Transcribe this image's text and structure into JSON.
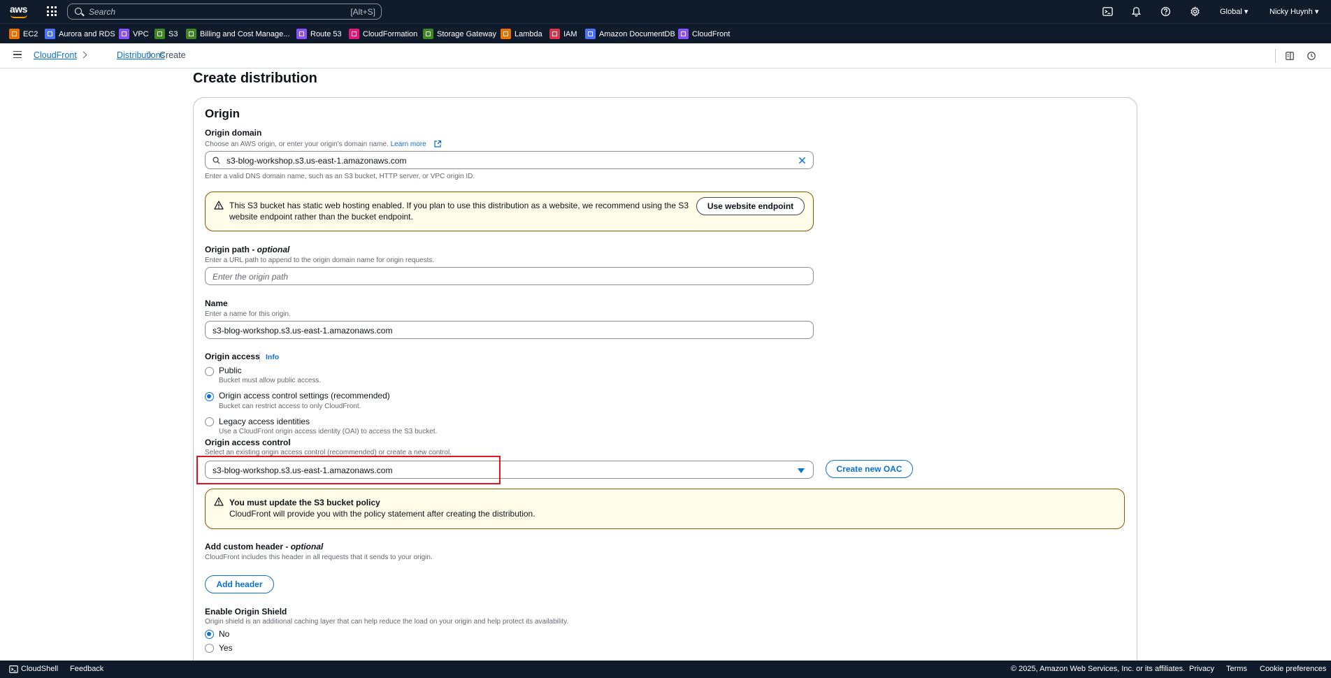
{
  "topnav": {
    "search_placeholder": "Search",
    "search_shortcut": "[Alt+S]",
    "region": "Global",
    "user": "Nicky Huynh"
  },
  "favorites": [
    {
      "label": "EC2",
      "color": "#ed7100"
    },
    {
      "label": "Aurora and RDS",
      "color": "#4d72f3"
    },
    {
      "label": "VPC",
      "color": "#8c4fff"
    },
    {
      "label": "S3",
      "color": "#3f8624"
    },
    {
      "label": "Billing and Cost Manage...",
      "color": "#3f8624"
    },
    {
      "label": "Route 53",
      "color": "#8c4fff"
    },
    {
      "label": "CloudFormation",
      "color": "#e7157b"
    },
    {
      "label": "Storage Gateway",
      "color": "#3f8624"
    },
    {
      "label": "Lambda",
      "color": "#ed7100"
    },
    {
      "label": "IAM",
      "color": "#dd344c"
    },
    {
      "label": "Amazon DocumentDB",
      "color": "#4d72f3"
    },
    {
      "label": "CloudFront",
      "color": "#8c4fff"
    }
  ],
  "breadcrumb": {
    "items": [
      "CloudFront",
      "Distributions",
      "Create"
    ]
  },
  "page": {
    "title": "Create distribution",
    "section_title": "Origin",
    "origin_domain": {
      "label": "Origin domain",
      "description": "Choose an AWS origin, or enter your origin's domain name.",
      "learn_more": "Learn more",
      "value": "s3-blog-workshop.s3.us-east-1.amazonaws.com",
      "hint": "Enter a valid DNS domain name, such as an S3 bucket, HTTP server, or VPC origin ID."
    },
    "website_alert": {
      "line1": "This S3 bucket has static web hosting enabled. If you plan to use this distribution as a website, we recommend using the S3",
      "line2": "website endpoint rather than the bucket endpoint.",
      "button": "Use website endpoint"
    },
    "origin_path": {
      "label": "Origin path - ",
      "optional": "optional",
      "description": "Enter a URL path to append to the origin domain name for origin requests.",
      "placeholder": "Enter the origin path"
    },
    "name": {
      "label": "Name",
      "description": "Enter a name for this origin.",
      "value": "s3-blog-workshop.s3.us-east-1.amazonaws.com"
    },
    "origin_access": {
      "label": "Origin access",
      "info": "Info",
      "options": [
        {
          "label": "Public",
          "desc": "Bucket must allow public access.",
          "selected": false
        },
        {
          "label": "Origin access control settings (recommended)",
          "desc": "Bucket can restrict access to only CloudFront.",
          "selected": true
        },
        {
          "label": "Legacy access identities",
          "desc": "Use a CloudFront origin access identity (OAI) to access the S3 bucket.",
          "selected": false
        }
      ]
    },
    "oac": {
      "label": "Origin access control",
      "description": "Select an existing origin access control (recommended) or create a new control.",
      "value": "s3-blog-workshop.s3.us-east-1.amazonaws.com",
      "create_button": "Create new OAC"
    },
    "policy_alert": {
      "title": "You must update the S3 bucket policy",
      "text": "CloudFront will provide you with the policy statement after creating the distribution."
    },
    "custom_header": {
      "label": "Add custom header - ",
      "optional": "optional",
      "description": "CloudFront includes this header in all requests that it sends to your origin.",
      "button": "Add header"
    },
    "origin_shield": {
      "label": "Enable Origin Shield",
      "description": "Origin shield is an additional caching layer that can help reduce the load on your origin and help protect its availability.",
      "options": [
        {
          "label": "No",
          "selected": true
        },
        {
          "label": "Yes",
          "selected": false
        }
      ]
    }
  },
  "footer": {
    "cloudshell": "CloudShell",
    "feedback": "Feedback",
    "copyright": "© 2025, Amazon Web Services, Inc. or its affiliates.",
    "privacy": "Privacy",
    "terms": "Terms",
    "cookie": "Cookie preferences"
  }
}
